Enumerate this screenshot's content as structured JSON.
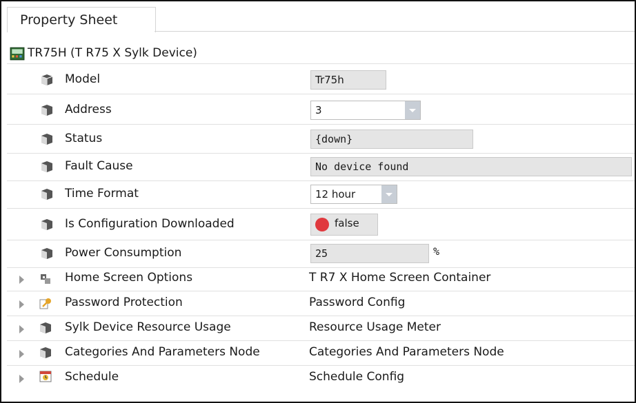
{
  "tab": {
    "label": "Property Sheet"
  },
  "root": {
    "label": "TR75H  (T R75 X Sylk Device)"
  },
  "properties": [
    {
      "label": "Model",
      "value": "Tr75h",
      "kind": "field"
    },
    {
      "label": "Address",
      "value": "3",
      "kind": "combo"
    },
    {
      "label": "Status",
      "value": "{down}",
      "kind": "field"
    },
    {
      "label": "Fault Cause",
      "value": "No device found",
      "kind": "field"
    },
    {
      "label": "Time Format",
      "value": "12 hour",
      "kind": "combo"
    },
    {
      "label": "Is Configuration Downloaded",
      "value": "false",
      "kind": "bool"
    },
    {
      "label": "Power Consumption",
      "value": "25",
      "unit": "%",
      "kind": "field"
    }
  ],
  "children": [
    {
      "label": "Home Screen Options",
      "value": "T R7 X Home Screen Container",
      "icon": "home-screen-icon"
    },
    {
      "label": "Password Protection",
      "value": "Password Config",
      "icon": "key-icon"
    },
    {
      "label": "Sylk Device Resource Usage",
      "value": "Resource Usage Meter",
      "icon": "cube-icon"
    },
    {
      "label": "Categories And Parameters Node",
      "value": "Categories And Parameters Node",
      "icon": "cube-icon"
    },
    {
      "label": "Schedule",
      "value": "Schedule Config",
      "icon": "schedule-icon"
    }
  ],
  "colors": {
    "bool_false": "#e0393e",
    "field_bg": "#e5e5e5"
  }
}
